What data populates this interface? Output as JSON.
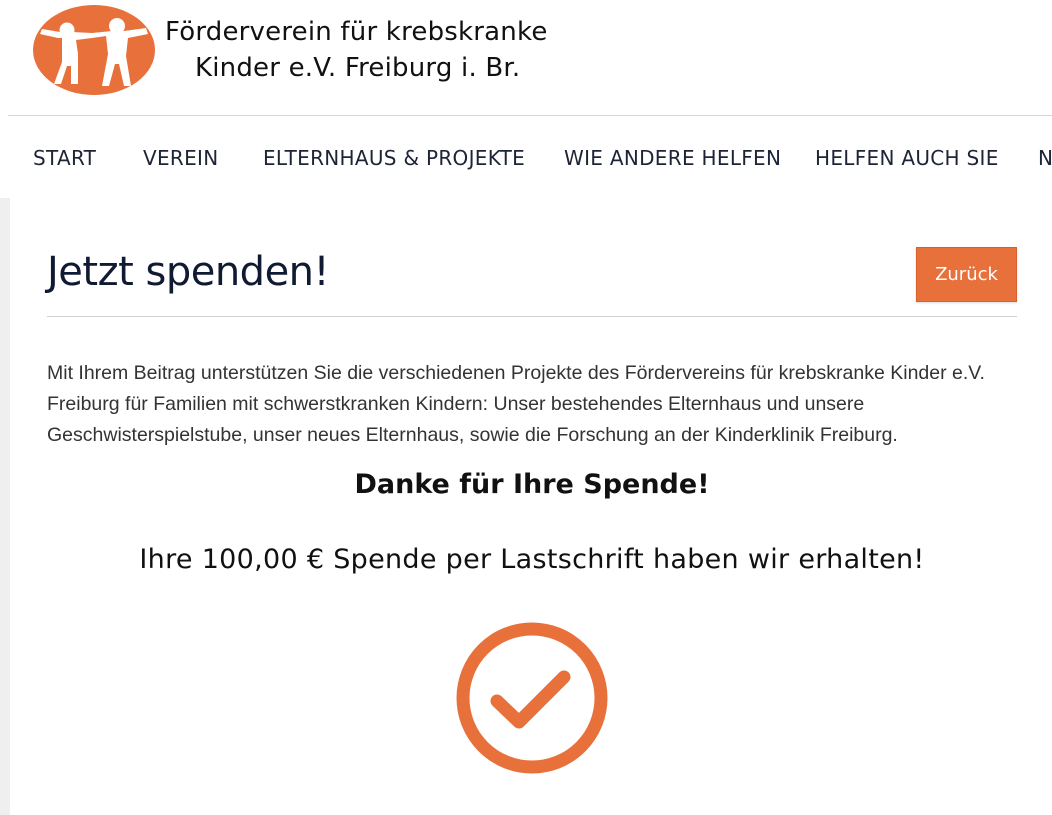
{
  "header": {
    "org_name_line1": "Förderverein für krebskranke",
    "org_name_line2": "Kinder e.V. Freiburg i. Br.",
    "logo_icon": "children-logo-icon"
  },
  "nav": {
    "items": [
      {
        "label": "START"
      },
      {
        "label": "VEREIN"
      },
      {
        "label": "ELTERNHAUS & PROJEKTE"
      },
      {
        "label": "WIE ANDERE HELFEN"
      },
      {
        "label": "HELFEN AUCH SIE"
      },
      {
        "label": "N"
      }
    ]
  },
  "main": {
    "title": "Jetzt spenden!",
    "back_button_label": "Zurück",
    "intro": "Mit Ihrem Beitrag unterstützen Sie die verschiedenen Projekte des Fördervereins für krebskranke Kinder e.V. Freiburg für Familien mit schwerstkranken Kindern: Unser bestehendes Elternhaus und unsere Geschwisterspielstube, unser neues Elternhaus, sowie die Forschung an der Kinderklinik Freiburg.",
    "thanks_heading": "Danke für Ihre Spende!",
    "confirmation": "Ihre 100,00 € Spende per Lastschrift haben wir erhalten!",
    "success_icon": "checkmark-circle-icon"
  },
  "colors": {
    "accent": "#e8703a",
    "text_dark": "#101a33",
    "body_text": "#333333"
  }
}
